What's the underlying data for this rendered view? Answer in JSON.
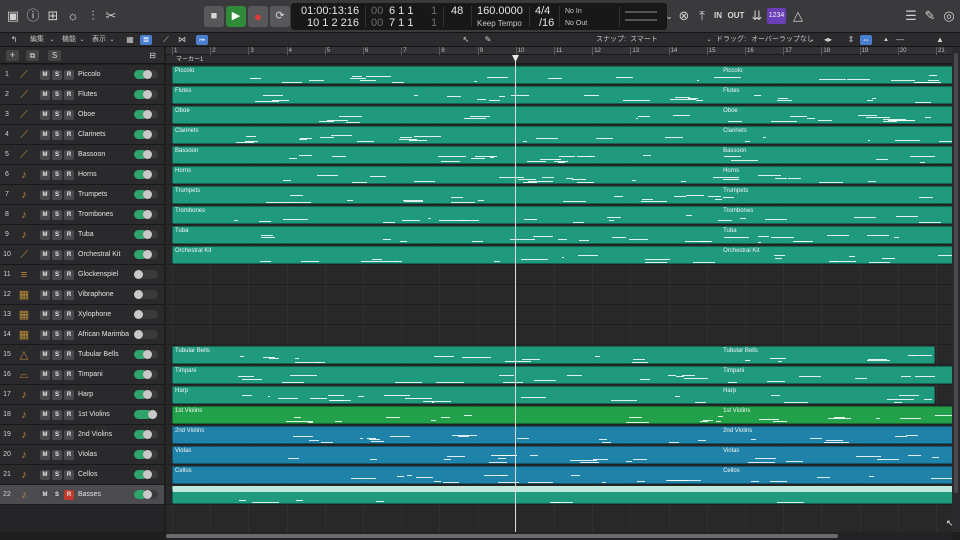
{
  "lcd": {
    "smpte": "01:00:13:16",
    "bars": "10  1  2 216",
    "loc_top": "6  1  1",
    "loc_bottom": "7  1  1",
    "loc_top_tail": "1",
    "loc_bottom_tail": "1",
    "dim_top": "00",
    "dim_bottom": "00",
    "sub_value": "48",
    "tempo": "160.0000",
    "tempo_mode": "Keep Tempo",
    "sig_top": "4/4",
    "sig_bottom": "/16",
    "midi_in": "No In",
    "midi_out": "No Out"
  },
  "control_bar": {
    "in_label": "IN",
    "out_label": "OUT",
    "cpu_label": "1234"
  },
  "toolbar2": {
    "edit_menu": "編集",
    "function_menu": "機能",
    "view_menu": "表示",
    "snap_label": "スナップ:",
    "snap_value": "スマート",
    "drag_label": "ドラッグ:",
    "drag_value": "オーバーラップなし"
  },
  "tracklist": {
    "add_symbol": "+",
    "s_label": "S"
  },
  "ruler": {
    "bars": [
      "1",
      "2",
      "3",
      "4",
      "5",
      "6",
      "7",
      "8",
      "9",
      "10",
      "11",
      "12",
      "13",
      "14",
      "15",
      "16",
      "17",
      "18",
      "19",
      "20",
      "21"
    ],
    "marker": "マーカー1"
  },
  "tracks": [
    {
      "num": "1",
      "name": "Piccolo",
      "icon": "flute-icon",
      "glyph": "⟋",
      "m": "M",
      "s": "S",
      "r": "R",
      "volume": 0.55
    },
    {
      "num": "2",
      "name": "Flutes",
      "icon": "flute-icon",
      "glyph": "⟋",
      "m": "M",
      "s": "S",
      "r": "R",
      "volume": 0.55
    },
    {
      "num": "3",
      "name": "Oboe",
      "icon": "oboe-icon",
      "glyph": "⟋",
      "m": "M",
      "s": "S",
      "r": "R",
      "volume": 0.55
    },
    {
      "num": "4",
      "name": "Clarinets",
      "icon": "clarinet-icon",
      "glyph": "⟋",
      "m": "M",
      "s": "S",
      "r": "R",
      "volume": 0.55
    },
    {
      "num": "5",
      "name": "Bassoon",
      "icon": "bassoon-icon",
      "glyph": "⟋",
      "m": "M",
      "s": "S",
      "r": "R",
      "volume": 0.55
    },
    {
      "num": "6",
      "name": "Horns",
      "icon": "horn-icon",
      "glyph": "♪",
      "m": "M",
      "s": "S",
      "r": "R",
      "volume": 0.55
    },
    {
      "num": "7",
      "name": "Trumpets",
      "icon": "trumpet-icon",
      "glyph": "♪",
      "m": "M",
      "s": "S",
      "r": "R",
      "volume": 0.55
    },
    {
      "num": "8",
      "name": "Trombones",
      "icon": "trombone-icon",
      "glyph": "♪",
      "m": "M",
      "s": "S",
      "r": "R",
      "volume": 0.55
    },
    {
      "num": "9",
      "name": "Tuba",
      "icon": "tuba-icon",
      "glyph": "♪",
      "m": "M",
      "s": "S",
      "r": "R",
      "volume": 0.55
    },
    {
      "num": "10",
      "name": "Orchestral Kit",
      "icon": "drum-icon",
      "glyph": "⟋",
      "m": "M",
      "s": "S",
      "r": "R",
      "volume": 0.55
    },
    {
      "num": "11",
      "name": "Glockenspiel",
      "icon": "glockenspiel-icon",
      "glyph": "≡",
      "m": "M",
      "s": "S",
      "r": "R",
      "volume": 0.0
    },
    {
      "num": "12",
      "name": "Vibraphone",
      "icon": "vibraphone-icon",
      "glyph": "▦",
      "m": "M",
      "s": "S",
      "r": "R",
      "volume": 0.0
    },
    {
      "num": "13",
      "name": "Xylophone",
      "icon": "xylophone-icon",
      "glyph": "▦",
      "m": "M",
      "s": "S",
      "r": "R",
      "volume": 0.0
    },
    {
      "num": "14",
      "name": "African Marimba",
      "icon": "marimba-icon",
      "glyph": "▦",
      "m": "M",
      "s": "S",
      "r": "R",
      "volume": 0.0
    },
    {
      "num": "15",
      "name": "Tubular Bells",
      "icon": "bells-icon",
      "glyph": "△",
      "m": "M",
      "s": "S",
      "r": "R",
      "volume": 0.55
    },
    {
      "num": "16",
      "name": "Timpani",
      "icon": "timpani-icon",
      "glyph": "⌓",
      "m": "M",
      "s": "S",
      "r": "R",
      "volume": 0.55
    },
    {
      "num": "17",
      "name": "Harp",
      "icon": "harp-icon",
      "glyph": "♪",
      "m": "M",
      "s": "S",
      "r": "R",
      "volume": 0.55
    },
    {
      "num": "18",
      "name": "1st Violins",
      "icon": "violin-icon",
      "glyph": "♪",
      "m": "M",
      "s": "S",
      "r": "R",
      "volume": 0.75
    },
    {
      "num": "19",
      "name": "2nd Violins",
      "icon": "violin-icon",
      "glyph": "♪",
      "m": "M",
      "s": "S",
      "r": "R",
      "volume": 0.55
    },
    {
      "num": "20",
      "name": "Violas",
      "icon": "viola-icon",
      "glyph": "♪",
      "m": "M",
      "s": "S",
      "r": "R",
      "volume": 0.55
    },
    {
      "num": "21",
      "name": "Cellos",
      "icon": "cello-icon",
      "glyph": "♪",
      "m": "M",
      "s": "S",
      "r": "R",
      "volume": 0.55
    },
    {
      "num": "22",
      "name": "Basses",
      "icon": "bass-icon",
      "glyph": "♪",
      "m": "M",
      "s": "S",
      "r": "R",
      "volume": 0.55,
      "selected": true,
      "rec": true
    }
  ],
  "regions": [
    {
      "lane": 0,
      "label": "Piccolo",
      "start": 1,
      "end": 22,
      "color": "#1f9a7d",
      "loop_label": "Piccolo"
    },
    {
      "lane": 1,
      "label": "Flutes",
      "start": 1,
      "end": 22,
      "color": "#1f9a7d",
      "loop_label": "Flutes"
    },
    {
      "lane": 2,
      "label": "Oboe",
      "start": 1,
      "end": 22,
      "color": "#1f9a7d",
      "loop_label": "Oboe"
    },
    {
      "lane": 3,
      "label": "Clarinets",
      "start": 1,
      "end": 22,
      "color": "#1f9a7d",
      "loop_label": "Clarinets"
    },
    {
      "lane": 4,
      "label": "Bassoon",
      "start": 1,
      "end": 22,
      "color": "#1f9a7d",
      "loop_label": "Bassoon"
    },
    {
      "lane": 5,
      "label": "Horns",
      "start": 1,
      "end": 22,
      "color": "#1f9a7d",
      "loop_label": "Horns"
    },
    {
      "lane": 6,
      "label": "Trumpets",
      "start": 1,
      "end": 22,
      "color": "#1f9a7d",
      "loop_label": "Trumpets"
    },
    {
      "lane": 7,
      "label": "Trombones",
      "start": 1,
      "end": 22,
      "color": "#1f9a7d",
      "loop_label": "Trombones"
    },
    {
      "lane": 8,
      "label": "Tuba",
      "start": 1,
      "end": 22,
      "color": "#1f9a7d",
      "loop_label": "Tuba"
    },
    {
      "lane": 9,
      "label": "Orchestral Kit",
      "start": 1,
      "end": 22,
      "color": "#1f9a7d",
      "loop_label": "Orchestral Kit"
    },
    {
      "lane": 14,
      "label": "Tubular Bells",
      "start": 1,
      "end": 21,
      "color": "#1f9a7d",
      "loop_label": "Tubular Bells"
    },
    {
      "lane": 15,
      "label": "Timpani",
      "start": 1,
      "end": 22,
      "color": "#1f9a7d",
      "loop_label": "Timpani"
    },
    {
      "lane": 16,
      "label": "Harp",
      "start": 1,
      "end": 21,
      "color": "#1f9a7d",
      "loop_label": "Harp"
    },
    {
      "lane": 17,
      "label": "1st Violins",
      "start": 1,
      "end": 22,
      "color": "#22a14a",
      "loop_label": "1st Violins"
    },
    {
      "lane": 18,
      "label": "2nd Violins",
      "start": 1,
      "end": 22,
      "color": "#1f82a8",
      "loop_label": "2nd Violins"
    },
    {
      "lane": 19,
      "label": "Violas",
      "start": 1,
      "end": 22,
      "color": "#1f82a8",
      "loop_label": "Violas"
    },
    {
      "lane": 20,
      "label": "Cellos",
      "start": 1,
      "end": 22,
      "color": "#1f82a8",
      "loop_label": "Cellos"
    },
    {
      "lane": 21,
      "label": "Basses",
      "start": 1,
      "end": 22,
      "color": "#1f9a7d",
      "loop_label": "Basses",
      "selected": true
    }
  ],
  "playhead_bar": 10
}
